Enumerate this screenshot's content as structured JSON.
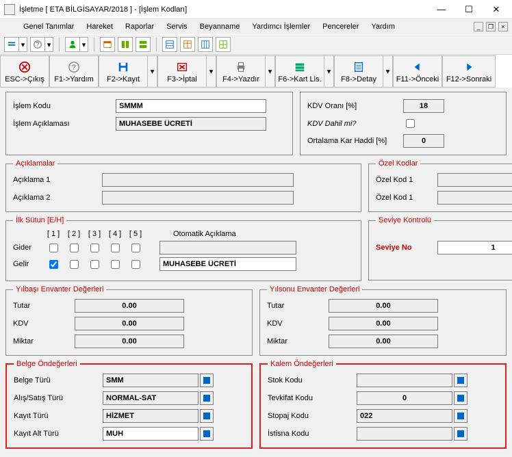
{
  "window": {
    "title": "İşletme [ ETA BİLGİSAYAR/2018 ]  - [İşlem Kodları]"
  },
  "menu": {
    "genel": "Genel Tanımlar",
    "hareket": "Hareket",
    "raporlar": "Raporlar",
    "servis": "Servis",
    "beyanname": "Beyanname",
    "yardimci": "Yardımcı İşlemler",
    "pencereler": "Pencereler",
    "yardim": "Yardım"
  },
  "fkeys": {
    "esc": "ESC->Çıkış",
    "f1": "F1->Yardım",
    "f2": "F2->Kayıt",
    "f3": "F3->İptal",
    "f4": "F4->Yazdır",
    "f6": "F6->Kart Lis.",
    "f8": "F8->Detay",
    "f11": "F11->Önceki",
    "f12": "F12->Sonraki"
  },
  "header": {
    "islem_kodu_lbl": "İşlem Kodu",
    "islem_kodu_val": "SMMM",
    "islem_acik_lbl": "İşlem Açıklaması",
    "islem_acik_val": "MUHASEBE ÜCRETİ",
    "kdv_orani_lbl": "KDV Oranı  [%]",
    "kdv_orani_val": "18",
    "kdv_dahil_lbl": "KDV Dahil mi?",
    "ort_kar_lbl": "Ortalama Kar Haddi [%]",
    "ort_kar_val": "0"
  },
  "aciklamalar": {
    "legend": "Açıklamalar",
    "a1_lbl": "Açıklama 1",
    "a1_val": "",
    "a2_lbl": "Açıklama 2",
    "a2_val": ""
  },
  "ozel": {
    "legend": "Özel Kodlar",
    "k1_lbl": "Özel Kod 1",
    "k1_val": "",
    "k2_lbl": "Özel Kod 1",
    "k2_val": ""
  },
  "ilksutun": {
    "legend": "İlk Sütun [E/H]",
    "cols": [
      "[ 1 ]",
      "[ 2 ]",
      "[ 3 ]",
      "[ 4 ]",
      "[ 5 ]"
    ],
    "oto_lbl": "Otomatik Açıklama",
    "gider_lbl": "Gider",
    "gider_chk": [
      false,
      false,
      false,
      false,
      false
    ],
    "gider_oto": "",
    "gelir_lbl": "Gelir",
    "gelir_chk": [
      true,
      false,
      false,
      false,
      false
    ],
    "gelir_oto": "MUHASEBE ÜCRETİ"
  },
  "seviye": {
    "legend": "Seviye Kontrolü",
    "lbl": "Seviye No",
    "val": "1"
  },
  "yilbasi": {
    "legend": "Yılbaşı Envanter Değerleri",
    "tutar_lbl": "Tutar",
    "tutar_val": "0.00",
    "kdv_lbl": "KDV",
    "kdv_val": "0.00",
    "miktar_lbl": "Miktar",
    "miktar_val": "0.00"
  },
  "yilsonu": {
    "legend": "Yılsonu Envanter Değerleri",
    "tutar_lbl": "Tutar",
    "tutar_val": "0.00",
    "kdv_lbl": "KDV",
    "kdv_val": "0.00",
    "miktar_lbl": "Miktar",
    "miktar_val": "0.00"
  },
  "belge": {
    "legend": "Belge Öndeğerleri",
    "turu_lbl": "Belge Türü",
    "turu_val": "SMM",
    "alis_lbl": "Alış/Satış Türü",
    "alis_val": "NORMAL-SAT",
    "kayit_lbl": "Kayıt Türü",
    "kayit_val": "HİZMET",
    "alt_lbl": "Kayıt Alt Türü",
    "alt_val": "MUH"
  },
  "kalem": {
    "legend": "Kalem Öndeğerleri",
    "stok_lbl": "Stok Kodu",
    "stok_val": "",
    "tevkifat_lbl": "Tevkifat Kodu",
    "tevkifat_val": "0",
    "stopaj_lbl": "Stopaj Kodu",
    "stopaj_val": "022",
    "istisna_lbl": "İstisna Kodu",
    "istisna_val": ""
  }
}
